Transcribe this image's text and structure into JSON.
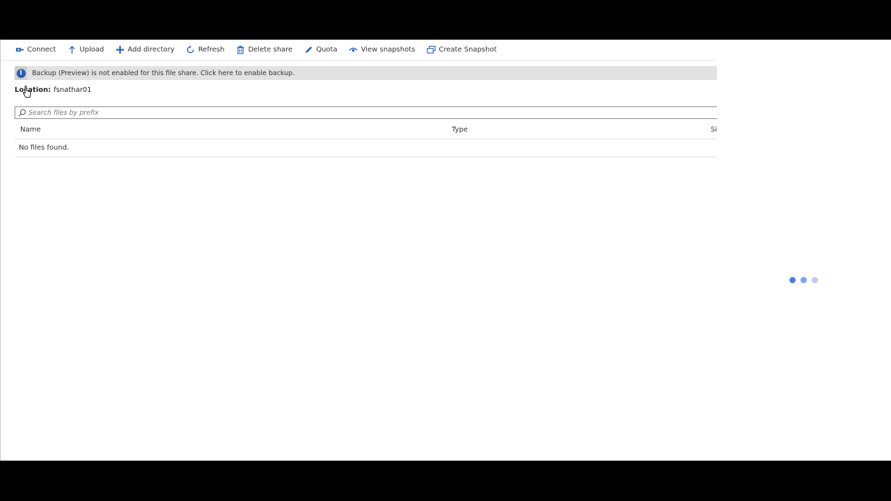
{
  "toolbar": {
    "connect": "Connect",
    "upload": "Upload",
    "add_directory": "Add directory",
    "refresh": "Refresh",
    "delete_share": "Delete share",
    "quota": "Quota",
    "view_snapshots": "View snapshots",
    "create_snapshot": "Create Snapshot"
  },
  "banner": {
    "icon": "info-icon",
    "message": "Backup (Preview) is not enabled for this file share. Click here to enable backup."
  },
  "location": {
    "label": "Location:",
    "value": "fsnathar01"
  },
  "search": {
    "placeholder": "Search files by prefix",
    "value": ""
  },
  "table": {
    "columns": [
      "Name",
      "Type",
      "Si"
    ],
    "empty_message": "No files found."
  },
  "colors": {
    "accent": "#2a5db0",
    "banner_bg": "#e2e2e2",
    "spinner_dots": [
      "#4a7fe0",
      "#7ea4ea",
      "#b9cdf3"
    ]
  }
}
